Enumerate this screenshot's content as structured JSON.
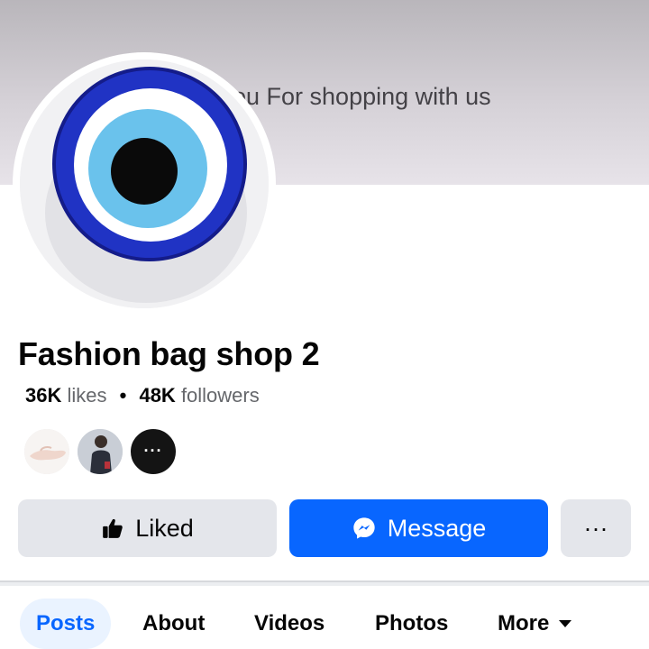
{
  "cover": {
    "text": "ou For shopping with us"
  },
  "page": {
    "name": "Fashion bag shop 2",
    "likes_count": "36K",
    "likes_label": "likes",
    "separator": "•",
    "followers_count": "48K",
    "followers_label": "followers"
  },
  "friends": {
    "more_label": "···"
  },
  "actions": {
    "liked_label": "Liked",
    "message_label": "Message",
    "more_label": "···"
  },
  "tabs": [
    {
      "label": "Posts",
      "active": true
    },
    {
      "label": "About",
      "active": false
    },
    {
      "label": "Videos",
      "active": false
    },
    {
      "label": "Photos",
      "active": false
    },
    {
      "label": "More",
      "active": false
    }
  ],
  "colors": {
    "accent": "#0866ff",
    "button_gray": "#e4e6eb",
    "active_tab_bg": "#eaf3ff"
  },
  "icons": {
    "liked": "thumbs-up-icon",
    "message": "messenger-icon",
    "more_tab": "caret-down-icon",
    "profile": "evil-eye-icon"
  }
}
